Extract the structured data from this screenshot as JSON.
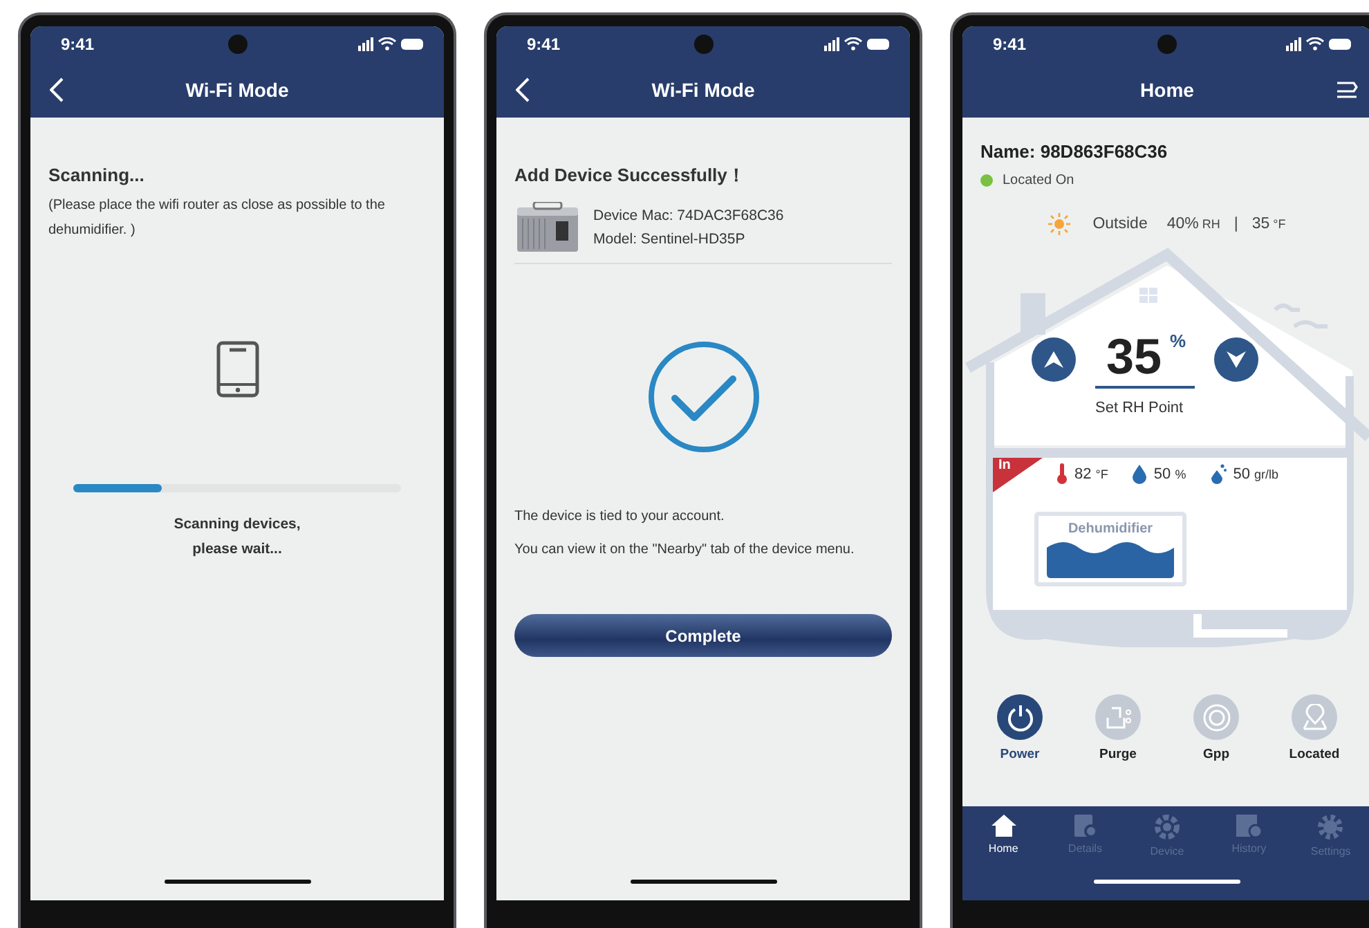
{
  "scan_screen": {
    "status_bar": {
      "time": "9:41"
    },
    "header": {
      "title": "Wi-Fi Mode"
    },
    "heading": "Scanning...",
    "note": "(Please place the wifi router as close as possible to the dehumidifier. )",
    "progress": {
      "level": 0.27
    },
    "status_lines": [
      "Scanning devices,",
      "please wait..."
    ]
  },
  "success_screen": {
    "status_bar": {
      "time": "9:41"
    },
    "header": {
      "title": "Wi-Fi Mode"
    },
    "heading": "Add Device Successfully！",
    "device_mac": "Device Mac: 74DAC3F68C36",
    "model": "Model: Sentinel-HD35P",
    "messages": [
      "The device is tied to your account.",
      "You can view it on the \"Nearby\" tab of the device menu."
    ],
    "button": "Complete"
  },
  "home_screen": {
    "status_bar": {
      "time": "9:41"
    },
    "header": {
      "title": "Home"
    },
    "name": "Name: 98D863F68C36",
    "location": "Located On",
    "outside": {
      "label": "Outside",
      "humidity": "40%",
      "humidity_unit": "RH",
      "separator": "|",
      "temperature": "35",
      "temperature_unit": "°F"
    },
    "setpoint": {
      "value": "35",
      "unit": "%",
      "label": "Set RH Point"
    },
    "indoor": {
      "badge": "In",
      "readings": [
        {
          "kind": "temperature",
          "value": "82",
          "unit": "°F"
        },
        {
          "kind": "humidity",
          "value": "50",
          "unit": "%"
        },
        {
          "kind": "grains",
          "value": "50",
          "unit": "gr/lb"
        }
      ]
    },
    "device_label": "Dehumidifier",
    "controls": [
      {
        "kind": "power",
        "label": "Power",
        "on": true
      },
      {
        "kind": "purge",
        "label": "Purge",
        "on": false
      },
      {
        "kind": "gpp",
        "label": "Gpp",
        "on": false
      },
      {
        "kind": "located",
        "label": "Located",
        "on": false
      }
    ],
    "tabs": [
      {
        "kind": "home",
        "label": "Home",
        "selected": true
      },
      {
        "kind": "details",
        "label": "Details",
        "selected": false
      },
      {
        "kind": "device",
        "label": "Device",
        "selected": false
      },
      {
        "kind": "history",
        "label": "History",
        "selected": false
      },
      {
        "kind": "settings",
        "label": "Settings",
        "selected": false
      }
    ]
  }
}
